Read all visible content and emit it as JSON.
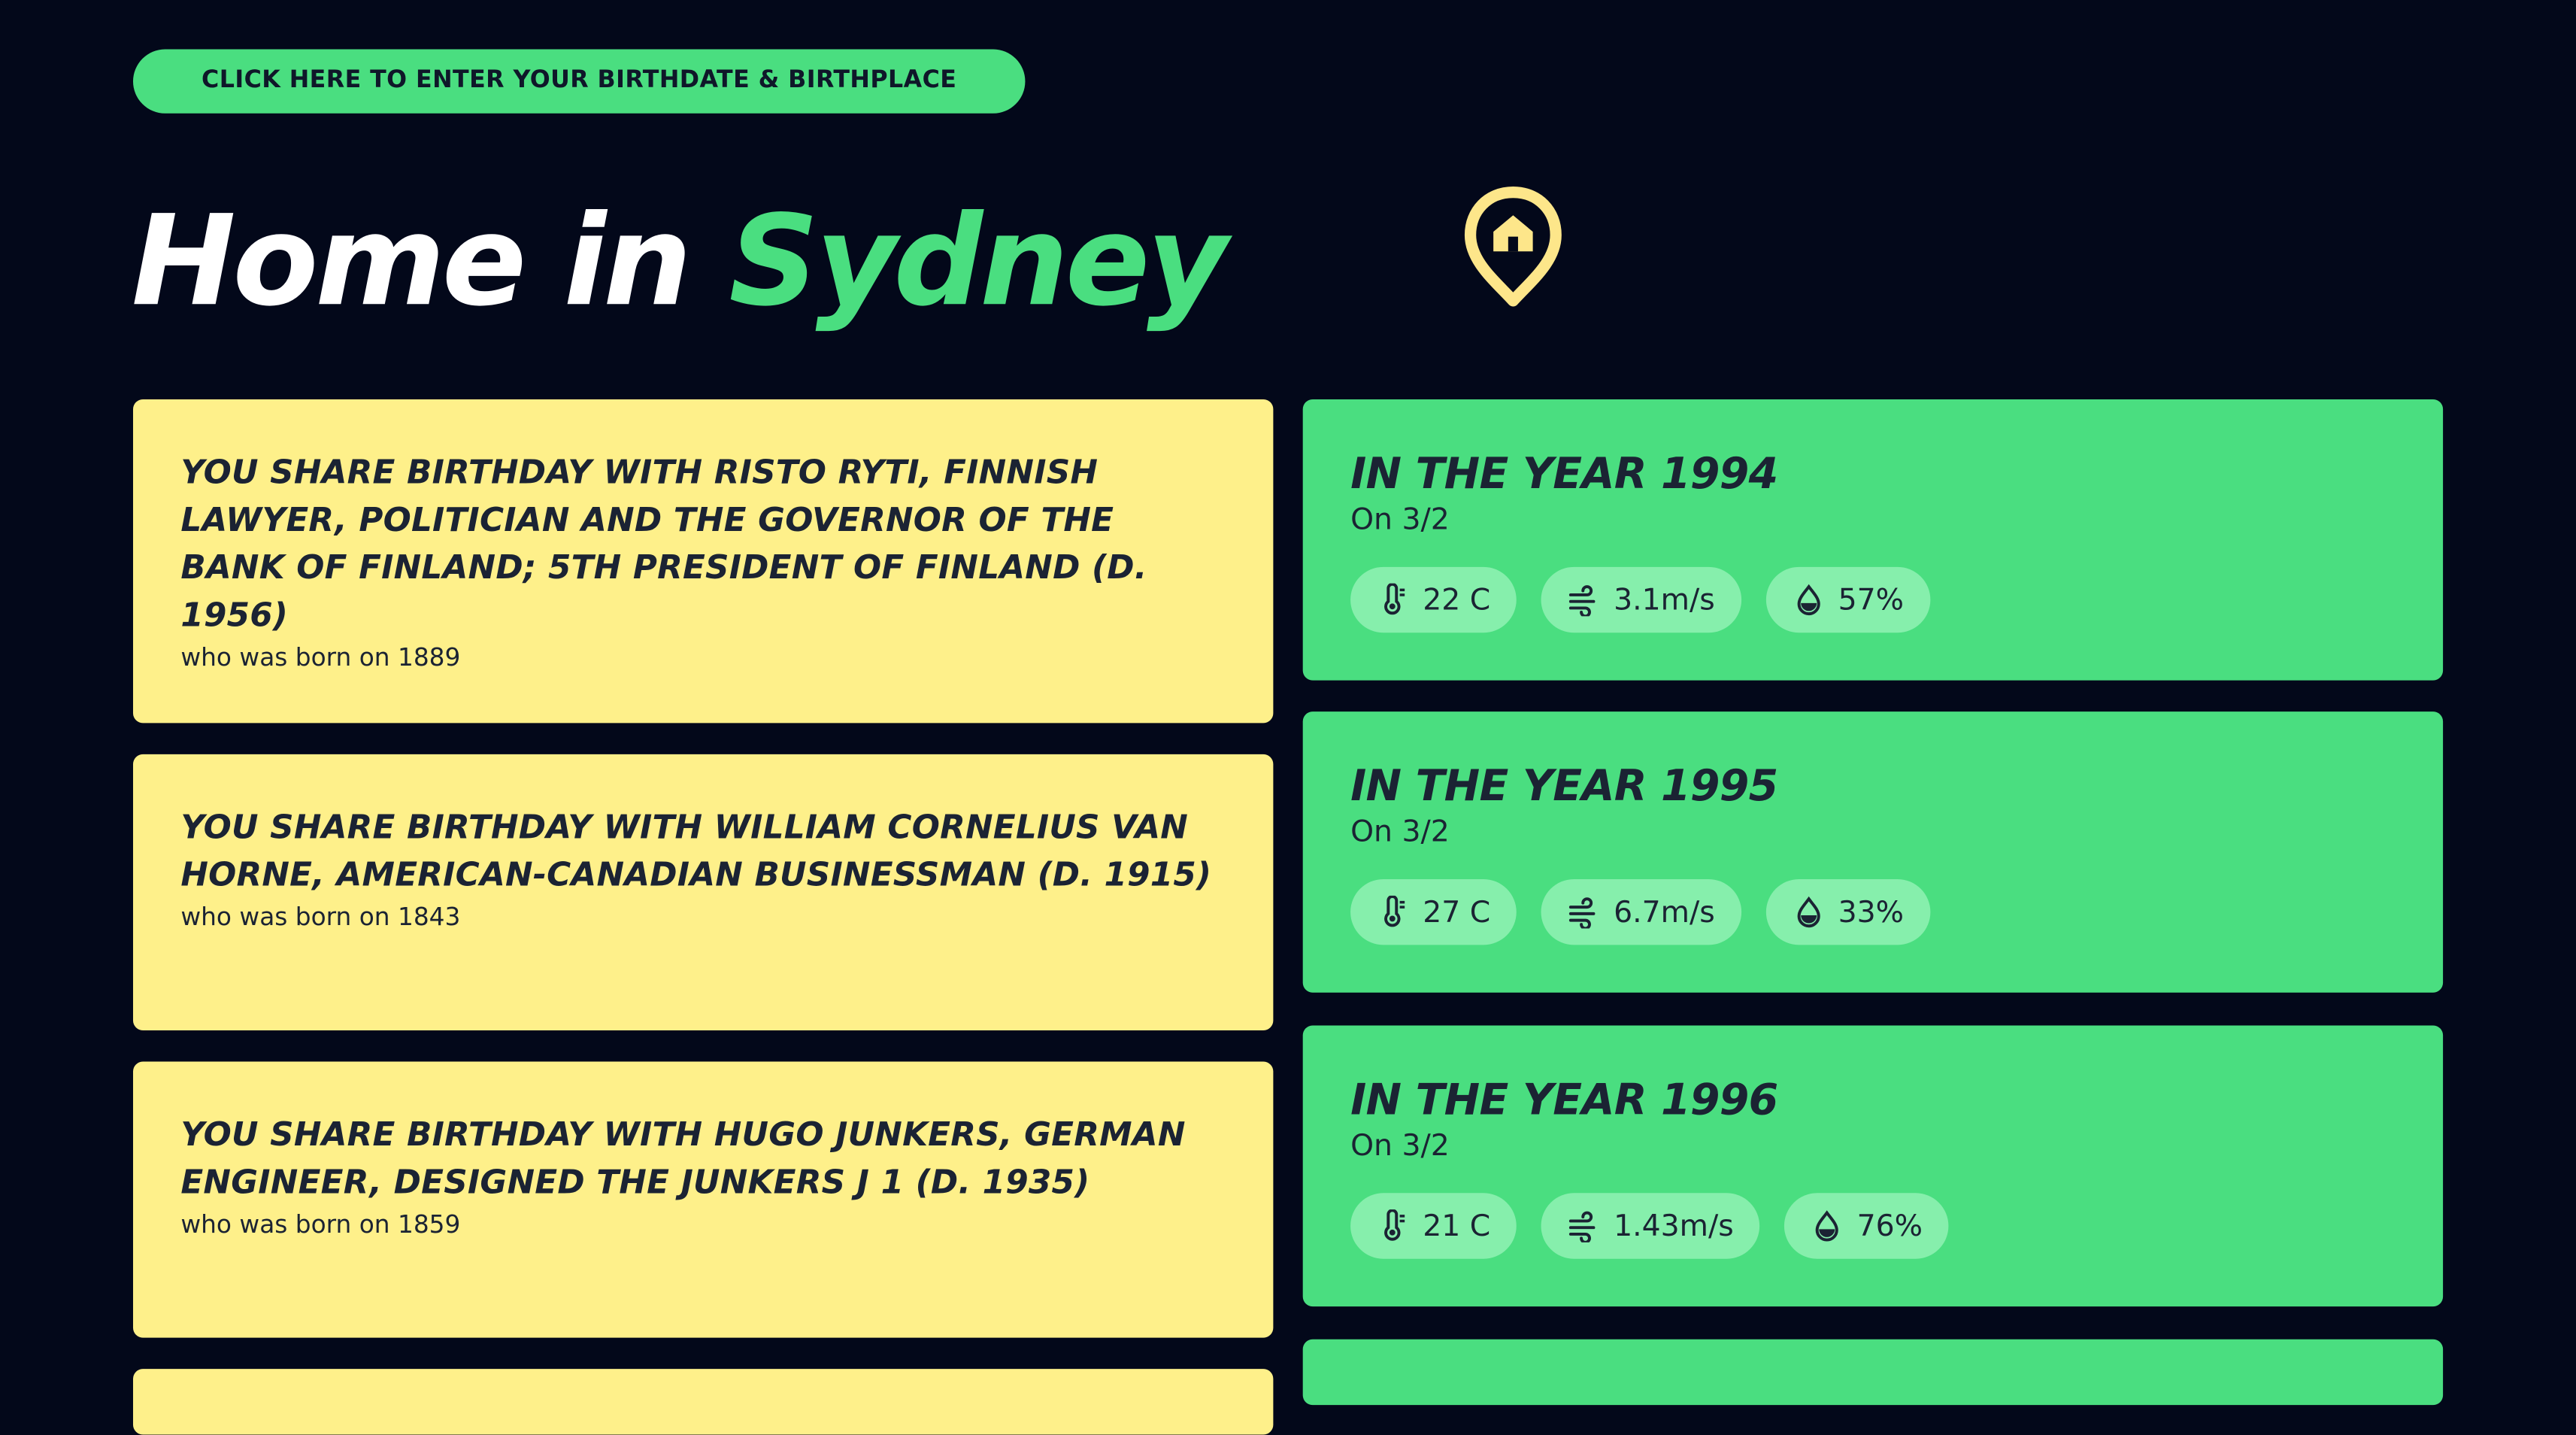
{
  "cta": {
    "label": "CLICK HERE TO ENTER YOUR BIRTHDATE & BIRTHPLACE"
  },
  "header": {
    "prefix": "Home in",
    "city": "Sydney",
    "icon": "home-pin-icon"
  },
  "colors": {
    "background": "#03081a",
    "accent_green": "#4ade80",
    "pill_green": "#86efac",
    "card_yellow": "#fef08a",
    "pin_yellow": "#fde68a",
    "text_dark": "#1b2333"
  },
  "birthdays": [
    {
      "heading": "YOU SHARE BIRTHDAY WITH RISTO RYTI, FINNISH LAWYER, POLITICIAN AND THE GOVERNOR OF THE BANK OF FINLAND; 5TH PRESIDENT OF FINLAND (D. 1956)",
      "sub": "who was born on 1889"
    },
    {
      "heading": "YOU SHARE BIRTHDAY WITH WILLIAM CORNELIUS VAN HORNE, AMERICAN-CANADIAN BUSINESSMAN (D. 1915)",
      "sub": "who was born on 1843"
    },
    {
      "heading": "YOU SHARE BIRTHDAY WITH HUGO JUNKERS, GERMAN ENGINEER, DESIGNED THE JUNKERS J 1 (D. 1935)",
      "sub": "who was born on 1859"
    }
  ],
  "weather": [
    {
      "year": "IN THE YEAR 1994",
      "date": "On 3/2",
      "temp": "22 C",
      "wind": "3.1m/s",
      "humidity": "57%"
    },
    {
      "year": "IN THE YEAR 1995",
      "date": "On 3/2",
      "temp": "27 C",
      "wind": "6.7m/s",
      "humidity": "33%"
    },
    {
      "year": "IN THE YEAR 1996",
      "date": "On 3/2",
      "temp": "21 C",
      "wind": "1.43m/s",
      "humidity": "76%"
    }
  ],
  "icons": {
    "temperature": "thermometer-icon",
    "wind": "wind-icon",
    "humidity": "droplet-icon"
  }
}
